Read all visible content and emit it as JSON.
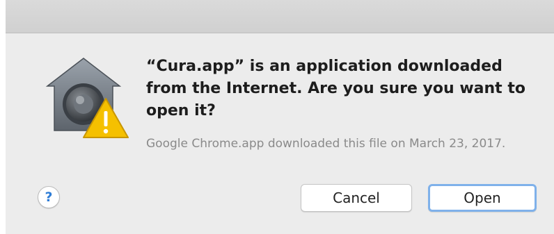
{
  "dialog": {
    "headline": "“Cura.app” is an application downloaded from the Internet. Are you sure you want to open it?",
    "subtext": "Google Chrome.app downloaded this file on March 23, 2017.",
    "icon": "gatekeeper-warning-icon"
  },
  "buttons": {
    "help_label": "?",
    "cancel_label": "Cancel",
    "open_label": "Open"
  },
  "colors": {
    "dialog_background": "#ececec",
    "focus_ring": "#7fb1ea",
    "help_accent": "#2f7dd6",
    "warning_yellow": "#f5c000"
  }
}
